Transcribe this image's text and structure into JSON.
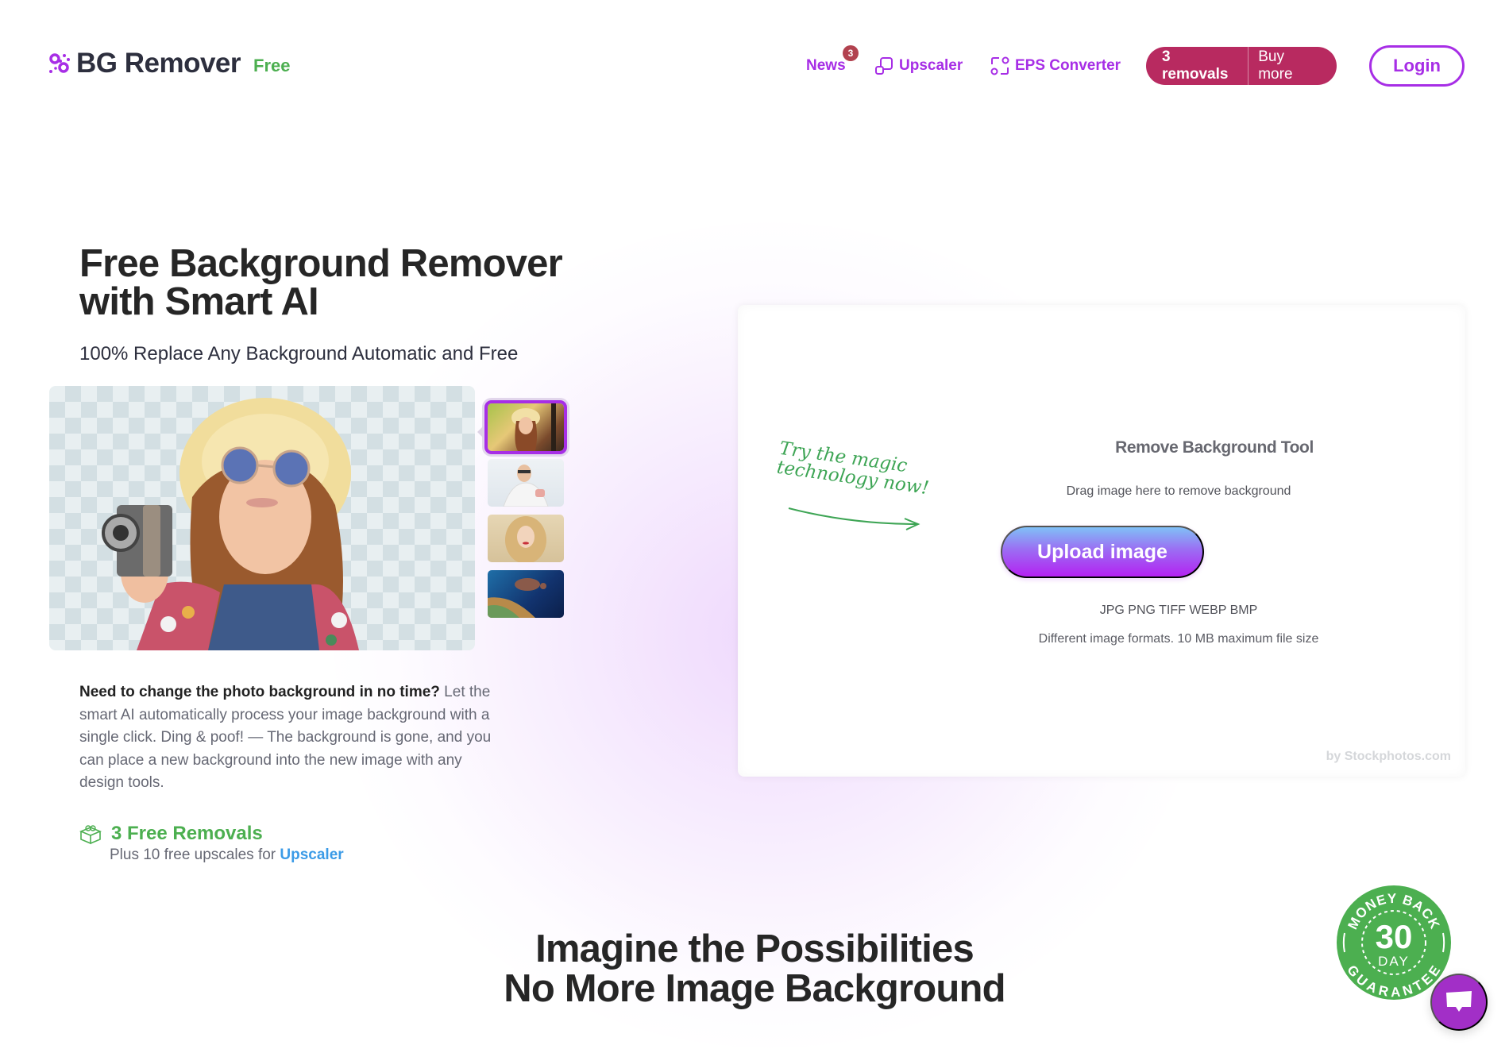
{
  "header": {
    "logo_text": "BG Remover",
    "logo_badge": "Free",
    "nav": [
      {
        "label": "News",
        "badge": "3",
        "icon": "none"
      },
      {
        "label": "Upscaler",
        "icon": "upscale-icon"
      },
      {
        "label": "EPS Converter",
        "icon": "convert-icon"
      }
    ],
    "removals_label": "3 removals",
    "buy_more_label": "Buy more",
    "login_label": "Login"
  },
  "hero": {
    "title_line1": "Free Background Remover",
    "title_line2": "with Smart AI",
    "subtitle": "100% Replace Any Background Automatic and Free",
    "thumbnails": [
      {
        "name": "woman-with-camera",
        "active": true
      },
      {
        "name": "dentist",
        "active": false
      },
      {
        "name": "blonde-woman",
        "active": false
      },
      {
        "name": "sea-turtle",
        "active": false
      }
    ],
    "description_bold": "Need to change the photo background in no time?",
    "description_rest": " Let the smart AI automatically process your image background with a single click. Ding & poof! — The background is gone, and you can place a new background into the new image with any design tools.",
    "free_title": "3 Free Removals",
    "free_sub_prefix": "Plus 10 free upscales for ",
    "free_sub_link": "Upscaler"
  },
  "tool": {
    "handwriting_line1": "Try the magic",
    "handwriting_line2": "technology now!",
    "title": "Remove Background Tool",
    "drag_text": "Drag image here to remove background",
    "upload_label": "Upload image",
    "formats": "JPG PNG TIFF WEBP BMP",
    "max_size": "Different image formats. 10 MB maximum file size",
    "credit": "by Stockphotos.com"
  },
  "bottom": {
    "title_line1": "Imagine the Possibilities",
    "title_line2": "No More Image Background"
  },
  "guarantee": {
    "top_text": "MONEY BACK",
    "number": "30",
    "unit": "DAY",
    "bottom_text": "GUARANTEE"
  },
  "colors": {
    "brand_purple": "#a72ee6",
    "green": "#4caf50",
    "pill": "#b82a60",
    "link_blue": "#3b9be7"
  }
}
